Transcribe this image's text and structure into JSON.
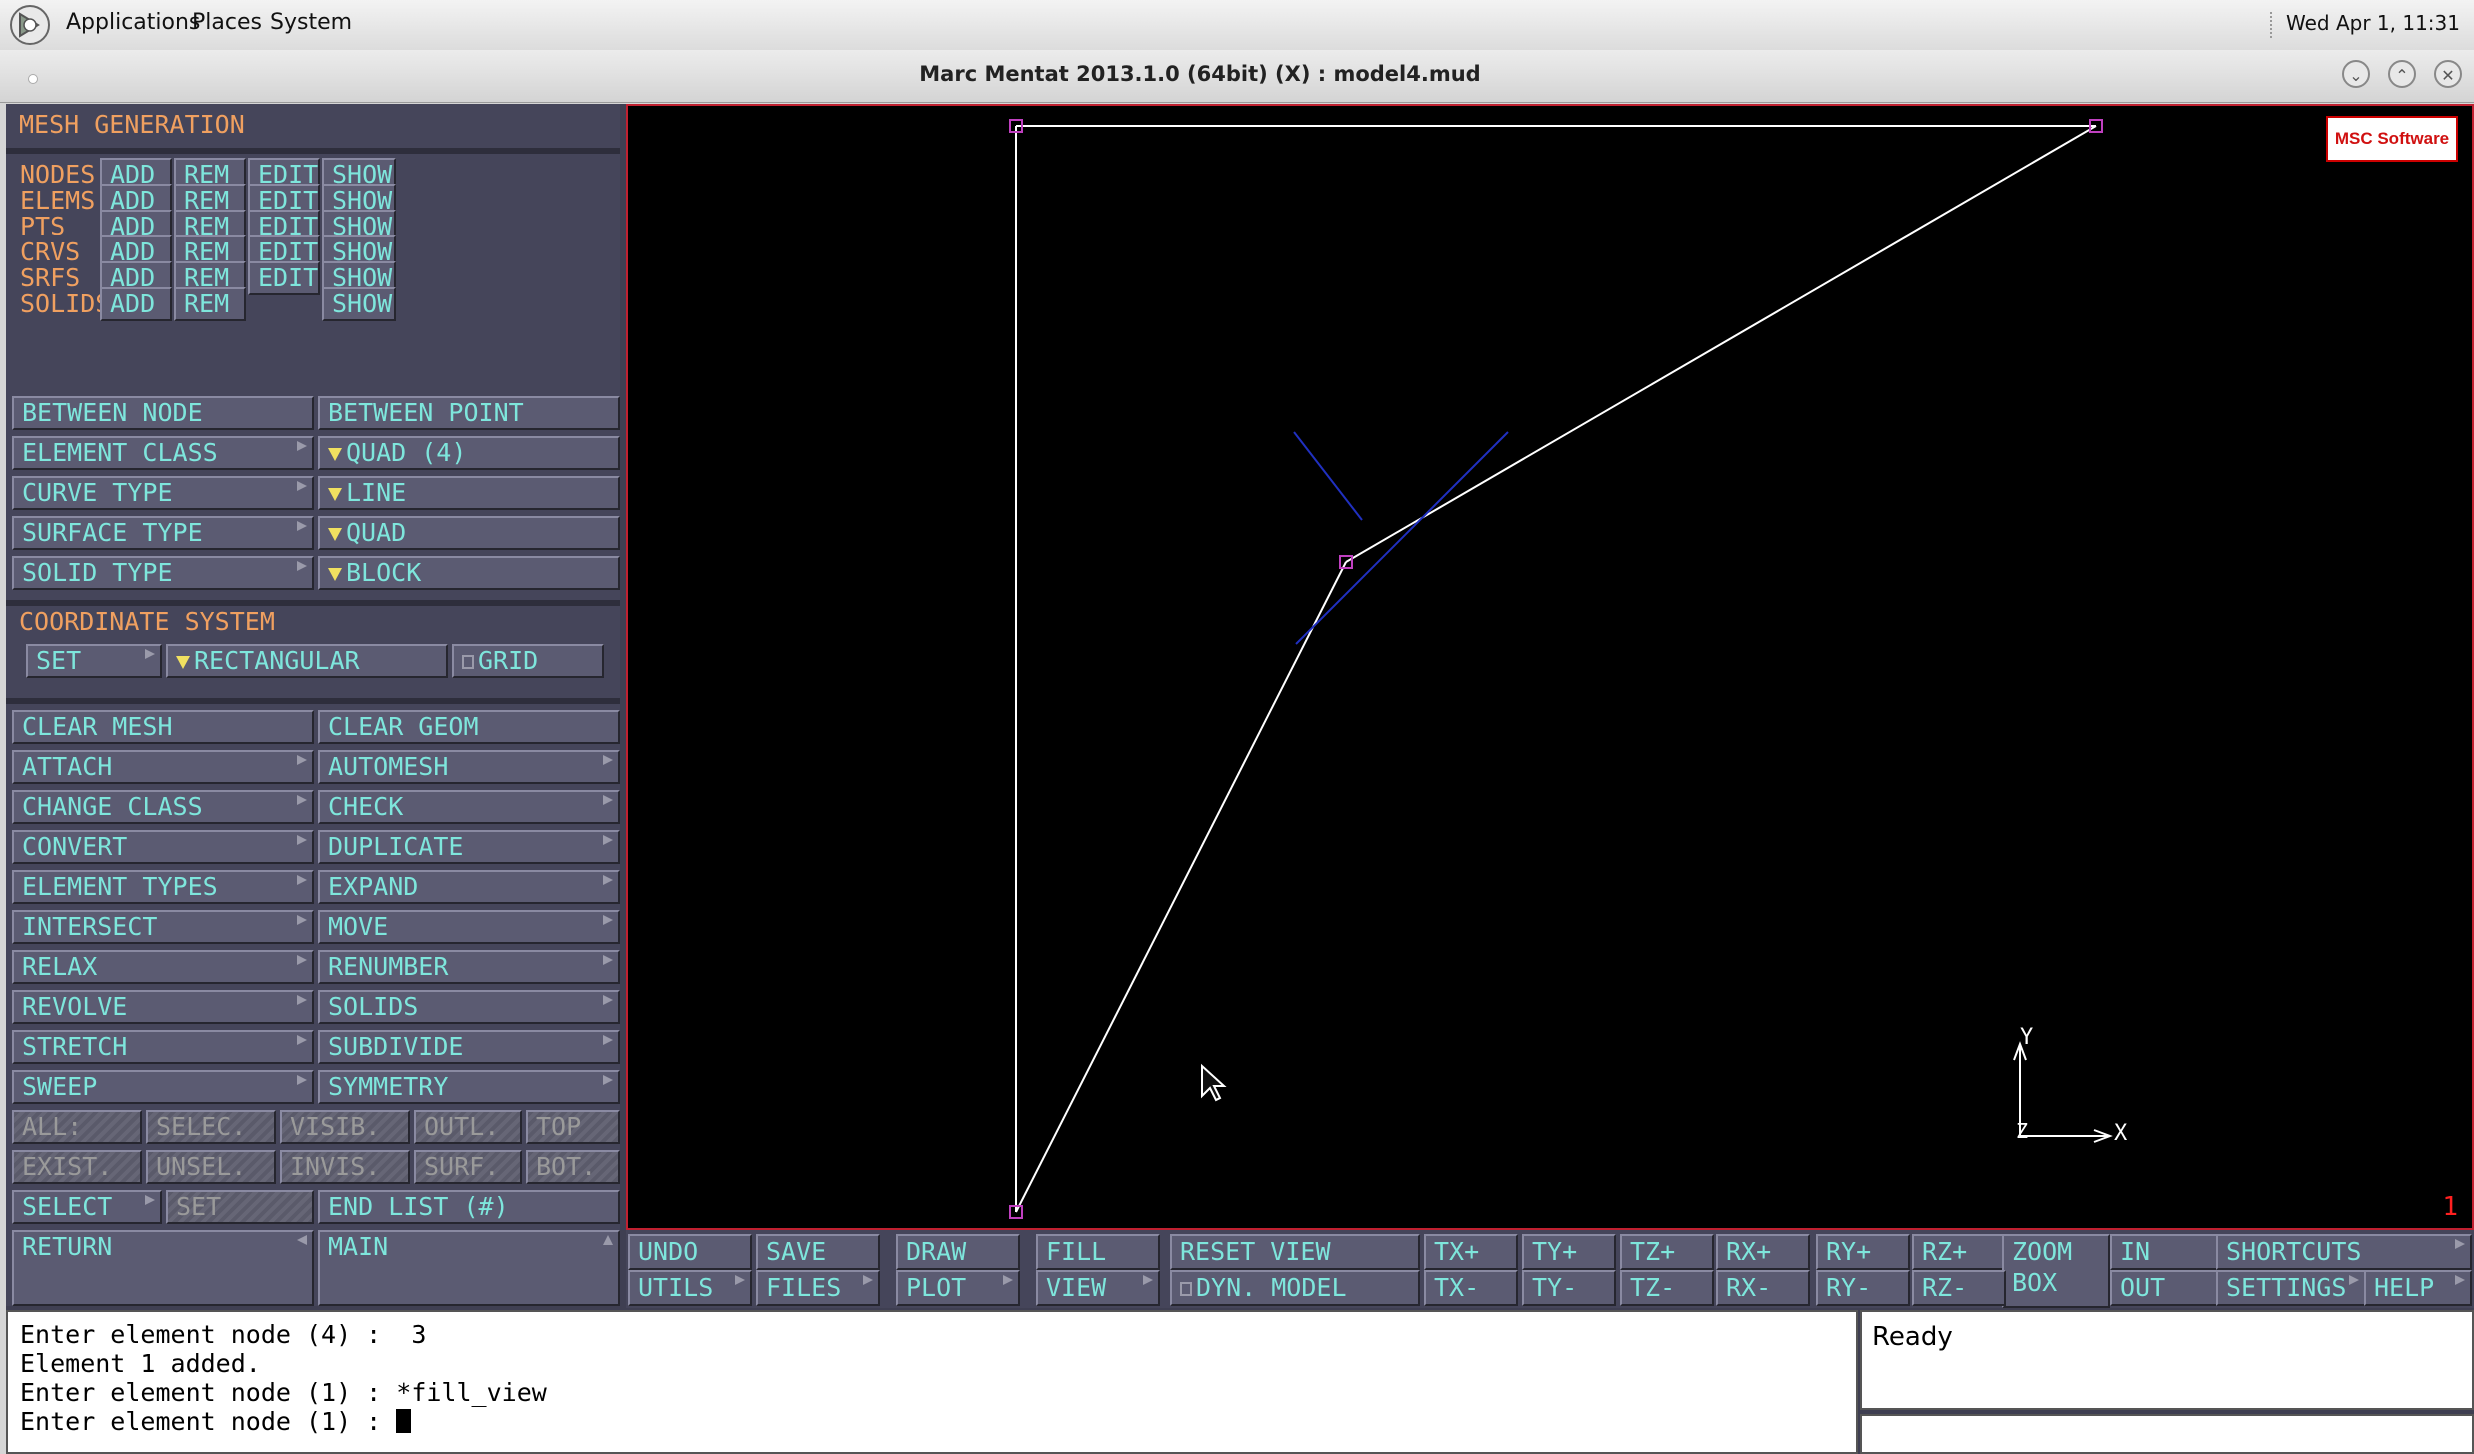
{
  "topbar": {
    "menus": [
      "Applications",
      "Places",
      "System"
    ],
    "clock": "Wed Apr  1, 11:31"
  },
  "window": {
    "title": "Marc Mentat 2013.1.0 (64bit) (X) : model4.mud",
    "controls": [
      "minimize",
      "maximize",
      "close"
    ]
  },
  "panel": {
    "header": "MESH GENERATION",
    "entity_rows": [
      {
        "label": "NODES",
        "buttons": [
          "ADD",
          "REM",
          "EDIT",
          "SHOW"
        ]
      },
      {
        "label": "ELEMS",
        "buttons": [
          "ADD",
          "REM",
          "EDIT",
          "SHOW"
        ]
      },
      {
        "label": "PTS",
        "buttons": [
          "ADD",
          "REM",
          "EDIT",
          "SHOW"
        ]
      },
      {
        "label": "CRVS",
        "buttons": [
          "ADD",
          "REM",
          "EDIT",
          "SHOW"
        ]
      },
      {
        "label": "SRFS",
        "buttons": [
          "ADD",
          "REM",
          "EDIT",
          "SHOW"
        ]
      },
      {
        "label": "SOLIDS",
        "buttons": [
          "ADD",
          "REM",
          "",
          "SHOW"
        ]
      }
    ],
    "between_node": "BETWEEN NODE",
    "between_point": "BETWEEN POINT",
    "type_rows": [
      {
        "label": "ELEMENT CLASS",
        "value": "QUAD (4)"
      },
      {
        "label": "CURVE TYPE",
        "value": "LINE"
      },
      {
        "label": "SURFACE TYPE",
        "value": "QUAD"
      },
      {
        "label": "SOLID TYPE",
        "value": "BLOCK"
      }
    ],
    "coord_header": "COORDINATE SYSTEM",
    "coord_set": "SET",
    "coord_value": "RECTANGULAR",
    "coord_grid": "GRID",
    "clear_mesh": "CLEAR MESH",
    "clear_geom": "CLEAR GEOM",
    "ops": [
      [
        "ATTACH",
        "AUTOMESH"
      ],
      [
        "CHANGE CLASS",
        "CHECK"
      ],
      [
        "CONVERT",
        "DUPLICATE"
      ],
      [
        "ELEMENT TYPES",
        "EXPAND"
      ],
      [
        "INTERSECT",
        "MOVE"
      ],
      [
        "RELAX",
        "RENUMBER"
      ],
      [
        "REVOLVE",
        "SOLIDS"
      ],
      [
        "STRETCH",
        "SUBDIVIDE"
      ],
      [
        "SWEEP",
        "SYMMETRY"
      ]
    ],
    "select_row1": [
      "ALL:",
      "SELEC.",
      "VISIB.",
      "OUTL.",
      "TOP"
    ],
    "select_row2": [
      "EXIST.",
      "UNSEL.",
      "INVIS.",
      "SURF.",
      "BOT."
    ],
    "select": "SELECT",
    "set": "SET",
    "end_list": "END LIST (#)",
    "return": "RETURN",
    "main": "MAIN"
  },
  "viewport": {
    "logo": "MSC Software",
    "number": "1",
    "axis_labels": {
      "y": "Y",
      "x": "X",
      "z": "Z"
    }
  },
  "toolbar": {
    "row1": [
      "UNDO",
      "SAVE",
      "DRAW",
      "FILL",
      "RESET VIEW",
      "TX+",
      "TY+",
      "TZ+",
      "RX+",
      "RY+",
      "RZ+",
      "ZOOM",
      "IN",
      "SHORTCUTS"
    ],
    "row2": [
      "UTILS",
      "FILES",
      "PLOT",
      "VIEW",
      "DYN. MODEL",
      "TX-",
      "TY-",
      "TZ-",
      "RX-",
      "RY-",
      "RZ-",
      "BOX",
      "OUT",
      "SETTINGS",
      "HELP"
    ]
  },
  "console": {
    "lines": [
      "Enter element node (4) :  3",
      "Element 1 added.",
      "Enter element node (1) : *fill_view",
      "Enter element node (1) : "
    ]
  },
  "status": {
    "text": "Ready"
  }
}
